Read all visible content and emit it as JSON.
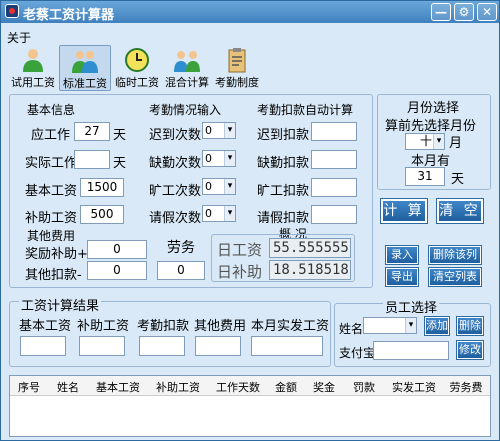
{
  "window": {
    "title": "老蔡工资计算器"
  },
  "menu": {
    "about": "关于"
  },
  "toolbar": {
    "items": [
      {
        "label": "试用工资",
        "icon": "person-green-icon"
      },
      {
        "label": "标准工资",
        "icon": "people-icon"
      },
      {
        "label": "临时工资",
        "icon": "clock-icon"
      },
      {
        "label": "混合计算",
        "icon": "group-icon"
      },
      {
        "label": "考勤制度",
        "icon": "clipboard-icon"
      }
    ]
  },
  "basic": {
    "title": "基本信息",
    "should_work": {
      "label": "应工作",
      "value": "27",
      "unit": "天"
    },
    "actual_work": {
      "label": "实际工作",
      "value": "",
      "unit": "天"
    },
    "base_salary": {
      "label": "基本工资",
      "value": "1500"
    },
    "allowance": {
      "label": "补助工资",
      "value": "500"
    }
  },
  "attendance": {
    "title": "考勤情况输入",
    "late": {
      "label": "迟到次数",
      "value": "0"
    },
    "missing": {
      "label": "缺勤次数",
      "value": "0"
    },
    "absent": {
      "label": "旷工次数",
      "value": "0"
    },
    "leave": {
      "label": "请假次数",
      "value": "0"
    }
  },
  "deduct": {
    "title": "考勤扣款自动计算",
    "late": "迟到扣款",
    "missing": "缺勤扣款",
    "absent": "旷工扣款",
    "leave": "请假扣款"
  },
  "month": {
    "title": "月份选择",
    "hint": "算前先选择月份",
    "month_value": "十",
    "month_unit": "月",
    "days_label": "本月有",
    "days_value": "31",
    "days_unit": "天"
  },
  "actions": {
    "calc": "计 算",
    "clear": "清 空"
  },
  "other": {
    "title": "其他费用",
    "bonus_label": "奖励补助+",
    "bonus_value": "0",
    "other_label": "其他扣款-",
    "other_value": "0",
    "labor_label": "劳务",
    "labor_value": "0"
  },
  "overview": {
    "title": "概 况",
    "daily_label": "日工资",
    "daily_value": "55.555555",
    "daily_sub_label": "日补助",
    "daily_sub_value": "18.518518"
  },
  "records": {
    "enter": "录入",
    "delete_row": "删除该列",
    "export": "导出",
    "clear_list": "清空列表"
  },
  "result": {
    "title": "工资计算结果",
    "cols": [
      "基本工资",
      "补助工资",
      "考勤扣款",
      "其他费用",
      "本月实发工资"
    ]
  },
  "employee": {
    "title": "员工选择",
    "name_label": "姓名",
    "add": "添加",
    "delete": "删除",
    "alipay_label": "支付宝",
    "modify": "修改"
  },
  "table": {
    "headers": [
      "序号",
      "姓名",
      "基本工资",
      "补助工资",
      "工作天数",
      "金额",
      "奖金",
      "罚款",
      "实发工资",
      "劳务费"
    ]
  }
}
